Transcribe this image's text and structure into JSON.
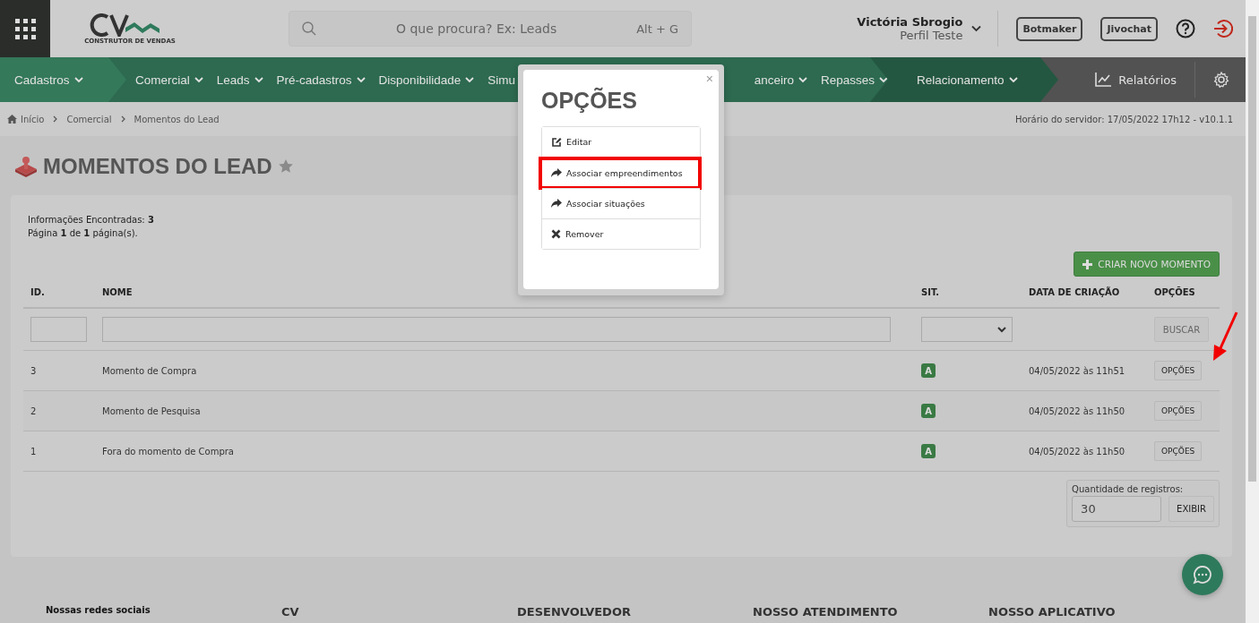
{
  "header": {
    "logo_caption": "CONSTRUTOR DE VENDAS",
    "search": {
      "placeholder": "O que procura? Ex: Leads",
      "shortcut": "Alt + G"
    },
    "user": {
      "name": "Victória Sbrogio",
      "profile": "Perfil Teste"
    },
    "buttons": [
      "Botmaker",
      "Jivochat"
    ]
  },
  "nav": {
    "groups": [
      {
        "items": [
          {
            "label": "Cadastros",
            "caret": true
          }
        ]
      },
      {
        "items": [
          {
            "label": "Comercial",
            "caret": true
          },
          {
            "label": "Leads",
            "caret": true
          },
          {
            "label": "Pré-cadastros",
            "caret": true
          },
          {
            "label": "Disponibilidade",
            "caret": true
          },
          {
            "label": "Simu",
            "caret": false
          },
          {
            "label": "anceiro",
            "caret": true
          },
          {
            "label": "Repasses",
            "caret": true
          }
        ]
      },
      {
        "items": [
          {
            "label": "Relacionamento",
            "caret": true
          }
        ]
      }
    ],
    "reports": "Relatórios"
  },
  "breadcrumb": {
    "items": [
      "Início",
      "Comercial",
      "Momentos do Lead"
    ],
    "server_time": "Horário do servidor: 17/05/2022 17h12 - v10.1.1"
  },
  "page": {
    "title": "MOMENTOS DO LEAD",
    "favorite": false,
    "summary": [
      "Informações Encontradas: **3**",
      "Página **1** de **1** página(s)."
    ],
    "create_button": "CRIAR NOVO MOMENTO"
  },
  "table": {
    "columns": [
      "ID.",
      "NOME",
      "SIT.",
      "DATA DE CRIAÇÃO",
      "OPÇÕES"
    ],
    "search_button": "BUSCAR",
    "rows": [
      {
        "id": "3",
        "name": "Momento de Compra",
        "status": "A",
        "color": "#3a7a44",
        "date": "04/05/2022 às 11h51",
        "options": "OPÇÕES",
        "pointed": true
      },
      {
        "id": "2",
        "name": "Momento de Pesquisa",
        "status": "A",
        "color": "#3a7a44",
        "date": "04/05/2022 às 11h50",
        "options": "OPÇÕES",
        "pointed": false
      },
      {
        "id": "1",
        "name": "Fora do momento de Compra",
        "status": "A",
        "color": "#3a7a44",
        "date": "04/05/2022 às 11h50",
        "options": "OPÇÕES",
        "pointed": false
      }
    ]
  },
  "page_size": {
    "label": "Quantidade de registros:",
    "value": "30",
    "button": "EXIBIR"
  },
  "footer": {
    "columns": [
      "Nossas redes sociais",
      "CV",
      "DESENVOLVEDOR",
      "NOSSO ATENDIMENTO",
      "NOSSO APLICATIVO"
    ]
  },
  "modal": {
    "title": "OPÇÕES",
    "close": "×",
    "items": [
      {
        "label": "Editar",
        "kind": "edit",
        "highlighted": false
      },
      {
        "label": "Associar empreendimentos",
        "kind": "associate",
        "highlighted": true
      },
      {
        "label": "Associar situações",
        "kind": "associate",
        "highlighted": false
      },
      {
        "label": "Remover",
        "kind": "remove",
        "highlighted": false
      }
    ]
  }
}
